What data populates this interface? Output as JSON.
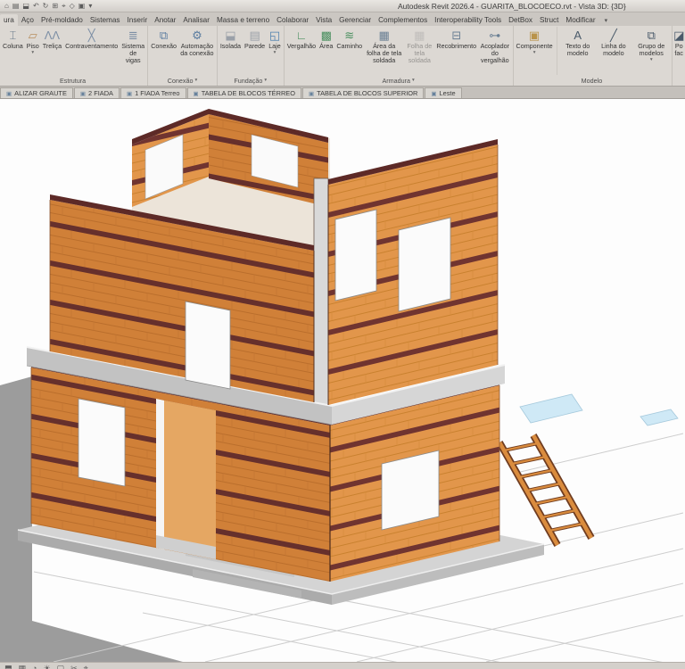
{
  "glyphs": {
    "dropdown": "▾",
    "view_tab": "▣"
  },
  "title_bar": {
    "title": "Autodesk Revit 2026.4 - GUARITA_BLOCOECO.rvt - Vista 3D: {3D}",
    "qat": [
      {
        "name": "app-home",
        "glyph": "⌂"
      },
      {
        "name": "open",
        "glyph": "▤"
      },
      {
        "name": "save",
        "glyph": "⬓"
      },
      {
        "name": "undo",
        "glyph": "↶"
      },
      {
        "name": "redo",
        "glyph": "↻"
      },
      {
        "name": "print",
        "glyph": "⊞"
      },
      {
        "name": "measure",
        "glyph": "⌖"
      },
      {
        "name": "tag",
        "glyph": "◇"
      },
      {
        "name": "default-3d-view",
        "glyph": "▣"
      },
      {
        "name": "customize",
        "glyph": "▾"
      }
    ]
  },
  "ribbon_tabs": [
    {
      "label": "ura"
    },
    {
      "label": "Aço"
    },
    {
      "label": "Pré-moldado"
    },
    {
      "label": "Sistemas"
    },
    {
      "label": "Inserir"
    },
    {
      "label": "Anotar"
    },
    {
      "label": "Analisar"
    },
    {
      "label": "Massa e terreno"
    },
    {
      "label": "Colaborar"
    },
    {
      "label": "Vista"
    },
    {
      "label": "Gerenciar"
    },
    {
      "label": "Complementos"
    },
    {
      "label": "Interoperability Tools"
    },
    {
      "label": "DetBox"
    },
    {
      "label": "Struct"
    },
    {
      "label": "Modificar"
    }
  ],
  "ribbon_panels": [
    {
      "name": "Estrutura",
      "arrow": "",
      "buttons": [
        {
          "label": "Coluna",
          "glyph": "⌶",
          "color": "#6b7b8c"
        },
        {
          "label": "Piso",
          "glyph": "▱",
          "color": "#b98f5e"
        },
        {
          "label": "Treliça",
          "glyph": "ΛΛ",
          "color": "#7d8fa5"
        },
        {
          "label": "Contraventamento",
          "glyph": "╳",
          "color": "#7d8fa5"
        },
        {
          "label": "Sistema de vigas",
          "glyph": "≣",
          "color": "#7d8fa5"
        }
      ]
    },
    {
      "name": "Conexão",
      "arrow": "▾",
      "buttons": [
        {
          "label": "Conexão",
          "glyph": "⧉",
          "color": "#5b7da0"
        },
        {
          "label": "Automação da conexão",
          "glyph": "⚙",
          "color": "#5b7da0"
        }
      ]
    },
    {
      "name": "Fundação",
      "arrow": "▾",
      "buttons": [
        {
          "label": "Isolada",
          "glyph": "⬓",
          "color": "#9aa0a8"
        },
        {
          "label": "Parede",
          "glyph": "▤",
          "color": "#9aa0a8"
        },
        {
          "label": "Laje",
          "glyph": "◱",
          "color": "#4c7fae"
        }
      ]
    },
    {
      "name": "Armadura",
      "arrow": "▾",
      "buttons": [
        {
          "label": "Vergalhão",
          "glyph": "∟",
          "color": "#4a8f5f"
        },
        {
          "label": "Área",
          "glyph": "▩",
          "color": "#4a8f5f"
        },
        {
          "label": "Caminho",
          "glyph": "≋",
          "color": "#4a8f5f"
        },
        {
          "label": "Área da folha de tela soldada",
          "glyph": "▦",
          "color": "#6a7f94"
        },
        {
          "label": "Folha de tela soldada",
          "glyph": "▦",
          "color": "#9a9a9a"
        },
        {
          "label": "Recobrimento",
          "glyph": "⊟",
          "color": "#6a7f94"
        },
        {
          "label": "Acoplador do vergalhão",
          "glyph": "⊶",
          "color": "#6a7f94"
        }
      ]
    },
    {
      "name": "Modelo",
      "arrow": "",
      "buttons": [
        {
          "label": "Componente",
          "glyph": "▣",
          "color": "#b9934a"
        },
        {
          "label": "Texto do modelo",
          "glyph": "A",
          "color": "#4a5a6a"
        },
        {
          "label": "Linha do modelo",
          "glyph": "╱",
          "color": "#4a5a6a"
        },
        {
          "label": "Grupo de modelos",
          "glyph": "⧉",
          "color": "#4a5a6a"
        }
      ]
    },
    {
      "name": "",
      "arrow": "",
      "buttons": [
        {
          "label": "Po fac",
          "glyph": "◪",
          "color": "#4a5a6a"
        }
      ]
    }
  ],
  "view_tabs": [
    "ALIZAR GRAUTE",
    "2 FIADA",
    "1 FIADA Terreo",
    "TABELA DE BLOCOS TÉRREO",
    "TABELA DE BLOCOS SUPERIOR",
    "Leste"
  ],
  "viewport": {
    "colors": {
      "brick_left_face": "#cf7d36",
      "brick_right_face": "#e2964b",
      "bond_beam_band": "#5d2a27",
      "slab": "#c2c2c2",
      "platform": "#d4d4d4",
      "glass_panel": "#cfe9f6",
      "ground_outside": "#9c9c9c",
      "background": "#fdfdfd"
    }
  },
  "status_icons": [
    "⬒",
    "▦",
    "◔",
    "☀",
    "▢",
    "✂",
    "⌖"
  ]
}
